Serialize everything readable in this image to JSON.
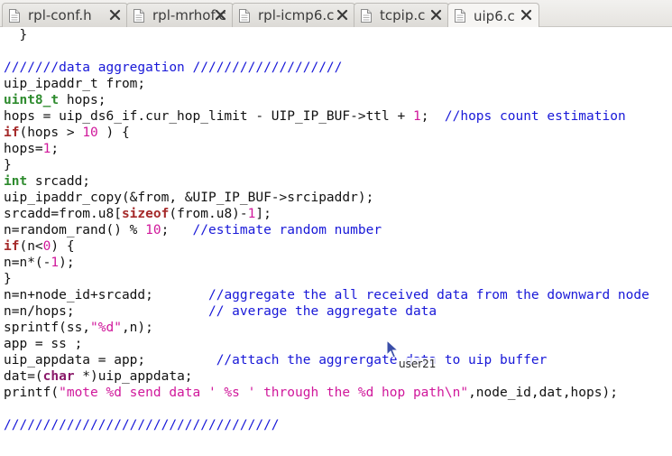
{
  "tabs": [
    {
      "label": "rpl-conf.h",
      "active": false
    },
    {
      "label": "rpl-mrhof.c",
      "active": false
    },
    {
      "label": "rpl-icmp6.c",
      "active": false
    },
    {
      "label": "tcpip.c",
      "active": false
    },
    {
      "label": "uip6.c",
      "active": true
    }
  ],
  "colors": {
    "type": "#2e8b2e",
    "keyword": "#a52a2a",
    "number": "#d0189b",
    "string": "#d0189b",
    "comment": "#1818d8",
    "text": "#111111"
  },
  "code": [
    [
      {
        "t": "  }",
        "k": "plain"
      }
    ],
    [
      {
        "t": "",
        "k": "plain"
      }
    ],
    [
      {
        "t": "///////data aggregation ///////////////////",
        "k": "cmt"
      }
    ],
    [
      {
        "t": "uip_ipaddr_t from;",
        "k": "plain"
      }
    ],
    [
      {
        "t": "uint8_t",
        "k": "type"
      },
      {
        "t": " hops;",
        "k": "plain"
      }
    ],
    [
      {
        "t": "hops = uip_ds6_if.cur_hop_limit - UIP_IP_BUF->ttl + ",
        "k": "plain"
      },
      {
        "t": "1",
        "k": "num"
      },
      {
        "t": ";  ",
        "k": "plain"
      },
      {
        "t": "//hops count estimation",
        "k": "cmt"
      }
    ],
    [
      {
        "t": "if",
        "k": "kw"
      },
      {
        "t": "(hops > ",
        "k": "plain"
      },
      {
        "t": "10",
        "k": "num"
      },
      {
        "t": " ) {",
        "k": "plain"
      }
    ],
    [
      {
        "t": "hops=",
        "k": "plain"
      },
      {
        "t": "1",
        "k": "num"
      },
      {
        "t": ";",
        "k": "plain"
      }
    ],
    [
      {
        "t": "}",
        "k": "plain"
      }
    ],
    [
      {
        "t": "int",
        "k": "type"
      },
      {
        "t": " srcadd;",
        "k": "plain"
      }
    ],
    [
      {
        "t": "uip_ipaddr_copy(&from, &UIP_IP_BUF->srcipaddr);",
        "k": "plain"
      }
    ],
    [
      {
        "t": "srcadd=from.u8[",
        "k": "plain"
      },
      {
        "t": "sizeof",
        "k": "kw"
      },
      {
        "t": "(from.u8)-",
        "k": "plain"
      },
      {
        "t": "1",
        "k": "num"
      },
      {
        "t": "];",
        "k": "plain"
      }
    ],
    [
      {
        "t": "n=random_rand() % ",
        "k": "plain"
      },
      {
        "t": "10",
        "k": "num"
      },
      {
        "t": ";   ",
        "k": "plain"
      },
      {
        "t": "//estimate random number",
        "k": "cmt"
      }
    ],
    [
      {
        "t": "if",
        "k": "kw"
      },
      {
        "t": "(n<",
        "k": "plain"
      },
      {
        "t": "0",
        "k": "num"
      },
      {
        "t": ") {",
        "k": "plain"
      }
    ],
    [
      {
        "t": "n=n*(-",
        "k": "plain"
      },
      {
        "t": "1",
        "k": "num"
      },
      {
        "t": ");",
        "k": "plain"
      }
    ],
    [
      {
        "t": "}",
        "k": "plain"
      }
    ],
    [
      {
        "t": "n=n+node_id+srcadd;       ",
        "k": "plain"
      },
      {
        "t": "//aggregate the all received data from the downward node",
        "k": "cmt"
      }
    ],
    [
      {
        "t": "n=n/hops;                 ",
        "k": "plain"
      },
      {
        "t": "// average the aggregate data",
        "k": "cmt"
      }
    ],
    [
      {
        "t": "sprintf(ss,",
        "k": "plain"
      },
      {
        "t": "\"%d\"",
        "k": "str"
      },
      {
        "t": ",n);",
        "k": "plain"
      }
    ],
    [
      {
        "t": "app = ss ;",
        "k": "plain"
      }
    ],
    [
      {
        "t": "uip_appdata = app;         ",
        "k": "plain"
      },
      {
        "t": "//attach the aggrergate data to uip buffer",
        "k": "cmt"
      }
    ],
    [
      {
        "t": "dat=(",
        "k": "plain"
      },
      {
        "t": "char",
        "k": "kw2"
      },
      {
        "t": " *)uip_appdata;",
        "k": "plain"
      }
    ],
    [
      {
        "t": "printf(",
        "k": "plain"
      },
      {
        "t": "\"mote %d send data ' %s ' through the %d hop path\\n\"",
        "k": "str"
      },
      {
        "t": ",node_id,dat,hops);",
        "k": "plain"
      }
    ],
    [
      {
        "t": "",
        "k": "plain"
      }
    ],
    [
      {
        "t": "///////////////////////////////////",
        "k": "cmt"
      }
    ]
  ],
  "cursor_label": "user21"
}
